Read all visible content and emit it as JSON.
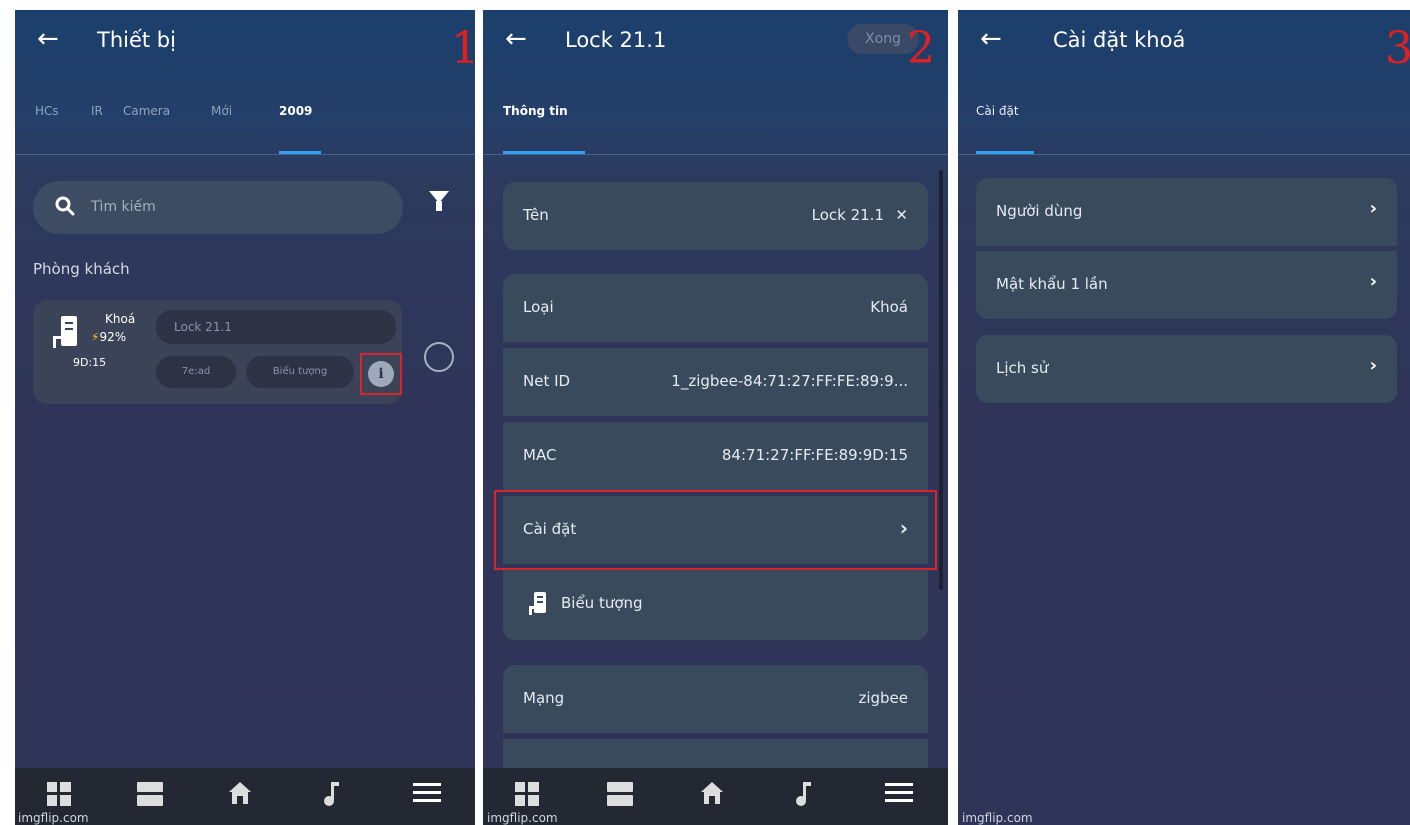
{
  "screen1": {
    "back_glyph": "←",
    "title": "Thiết bị",
    "step_number": "1",
    "tabs": [
      "HCs",
      "IR",
      "Camera",
      "Mới",
      "2009"
    ],
    "active_tab": "2009",
    "search_placeholder": "Tìm kiếm",
    "room_label": "Phòng khách",
    "device": {
      "name": "Khoá",
      "battery": "92%",
      "time": "9D:15",
      "label_field": "Lock 21.1",
      "pill_1": "7e:ad",
      "pill_2": "Biểu tượng",
      "info_glyph": "i"
    },
    "watermark": "imgflip.com"
  },
  "screen2": {
    "back_glyph": "←",
    "title": "Lock 21.1",
    "done_label": "Xong",
    "step_number": "2",
    "tab": "Thông tin",
    "name_row": {
      "label": "Tên",
      "value": "Lock 21.1",
      "clear_glyph": "✕"
    },
    "info_rows": [
      {
        "label": "Loại",
        "value": "Khoá"
      },
      {
        "label": "Net ID",
        "value": "1_zigbee-84:71:27:FF:FE:89:9..."
      },
      {
        "label": "MAC",
        "value": "84:71:27:FF:FE:89:9D:15"
      }
    ],
    "settings_row": {
      "label": "Cài đặt",
      "chevron": "›"
    },
    "icon_row": {
      "label": "Biểu tượng"
    },
    "network_row": {
      "label": "Mạng",
      "value": "zigbee"
    },
    "watermark": "imgflip.com"
  },
  "screen3": {
    "back_glyph": "←",
    "title": "Cài đặt khoá",
    "step_number": "3",
    "tab": "Cài đặt",
    "rows": [
      {
        "label": "Người dùng",
        "chevron": "›"
      },
      {
        "label": "Mật khẩu 1 lần",
        "chevron": "›"
      },
      {
        "label": "Lịch sử",
        "chevron": "›"
      }
    ],
    "watermark": "imgflip.com"
  },
  "colors": {
    "accent_blue": "#2f9ff3",
    "highlight_red": "#d7262b",
    "panel_bg": "#2f3459",
    "row_bg": "#394a5c",
    "bolt_yellow": "#f6c51b"
  }
}
